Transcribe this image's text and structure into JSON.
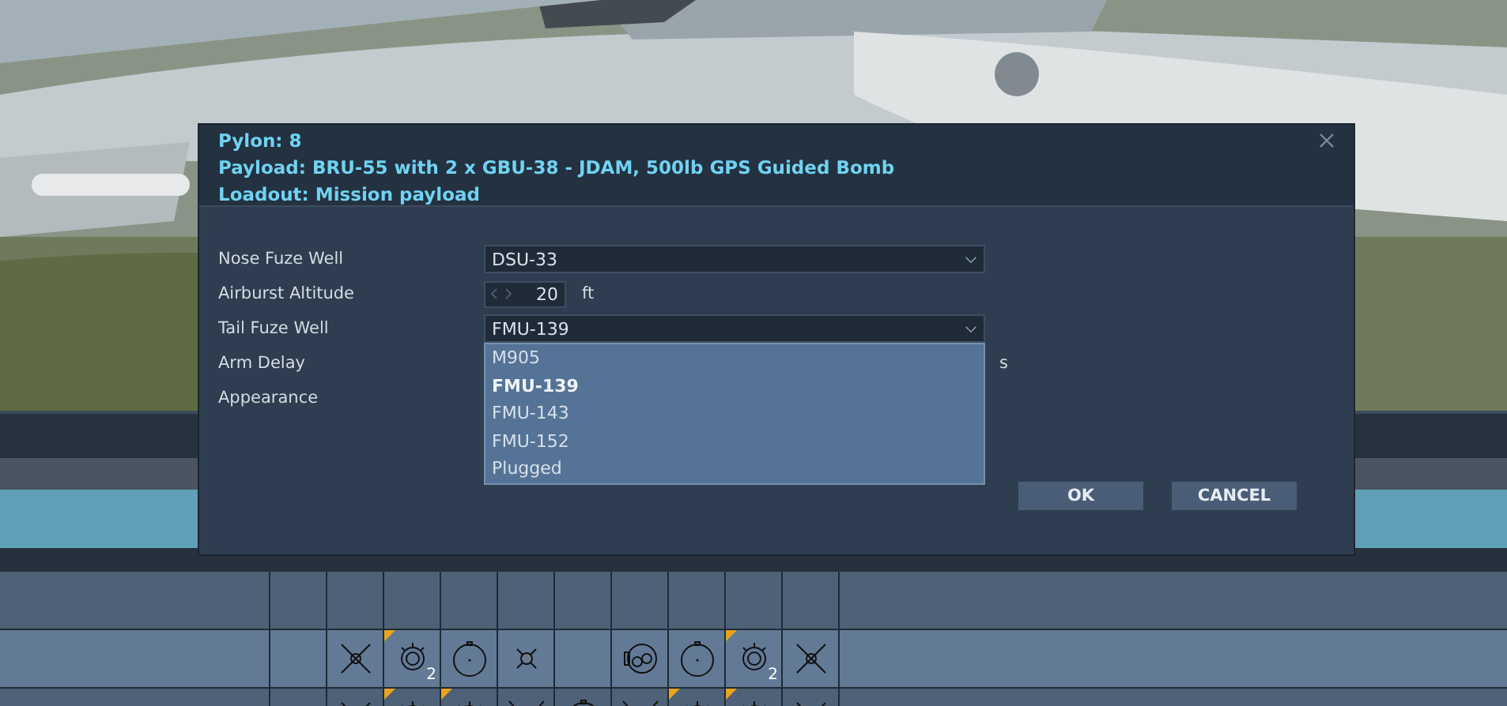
{
  "dialog": {
    "header": [
      "Pylon: 8",
      "Payload: BRU-55 with 2 x GBU-38 - JDAM, 500lb GPS Guided Bomb",
      "Loadout: Mission payload"
    ],
    "fields": [
      {
        "kind": "select",
        "label": "Nose Fuze Well",
        "value": "DSU-33"
      },
      {
        "kind": "number",
        "label": "Airburst Altitude",
        "value": "20",
        "unit": "ft"
      },
      {
        "kind": "select",
        "label": "Tail Fuze Well",
        "value": "FMU-139",
        "expanded": true
      },
      {
        "kind": "hidden",
        "label": "Arm Delay",
        "unit": "s"
      },
      {
        "kind": "hidden",
        "label": "Appearance"
      }
    ],
    "options": [
      {
        "label": "M905",
        "selected": false
      },
      {
        "label": "FMU-139",
        "selected": true
      },
      {
        "label": "FMU-143",
        "selected": false
      },
      {
        "label": "FMU-152",
        "selected": false
      },
      {
        "label": "Plugged",
        "selected": false
      }
    ],
    "buttons": [
      "OK",
      "CANCEL"
    ]
  },
  "grid": {
    "rows": [
      [
        {
          "kind": "empty",
          "flagged": false
        },
        {
          "kind": "empty",
          "flagged": false
        },
        {
          "kind": "empty",
          "flagged": false
        },
        {
          "kind": "empty",
          "flagged": false
        },
        {
          "kind": "empty",
          "flagged": false
        },
        {
          "kind": "empty",
          "flagged": false
        },
        {
          "kind": "empty",
          "flagged": false
        },
        {
          "kind": "empty",
          "flagged": false
        },
        {
          "kind": "empty",
          "flagged": false
        },
        {
          "kind": "empty",
          "flagged": false
        }
      ],
      [
        {
          "kind": "empty",
          "flagged": false
        },
        {
          "kind": "cross",
          "flagged": false
        },
        {
          "kind": "bomb",
          "flagged": true,
          "count": "2"
        },
        {
          "kind": "circle",
          "flagged": false
        },
        {
          "kind": "small-cross",
          "flagged": false
        },
        {
          "kind": "empty",
          "flagged": false
        },
        {
          "kind": "pod",
          "flagged": false
        },
        {
          "kind": "circle",
          "flagged": false
        },
        {
          "kind": "bomb",
          "flagged": true,
          "count": "2"
        },
        {
          "kind": "cross",
          "flagged": false
        }
      ],
      [
        {
          "kind": "empty",
          "flagged": false
        },
        {
          "kind": "cross",
          "flagged": false
        },
        {
          "kind": "bomb",
          "flagged": true
        },
        {
          "kind": "bomb",
          "flagged": true
        },
        {
          "kind": "wings",
          "flagged": false
        },
        {
          "kind": "circle",
          "flagged": false
        },
        {
          "kind": "wings",
          "flagged": false
        },
        {
          "kind": "bomb",
          "flagged": true
        },
        {
          "kind": "bomb",
          "flagged": true
        },
        {
          "kind": "cross",
          "flagged": false
        }
      ]
    ]
  }
}
